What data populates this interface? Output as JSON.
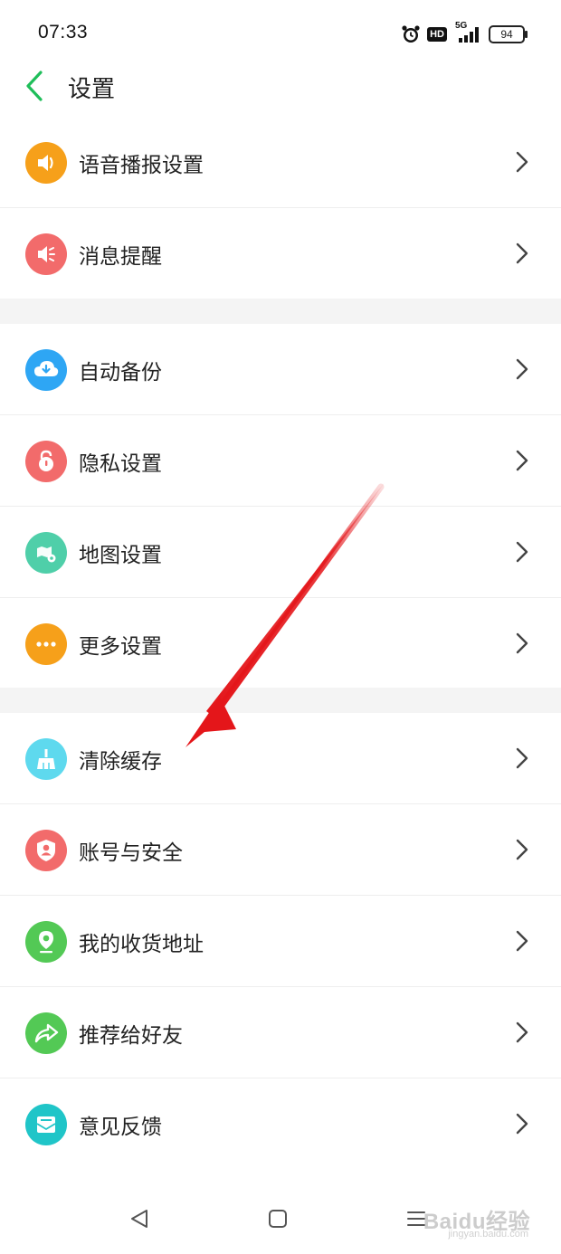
{
  "status_bar": {
    "time": "07:33",
    "network": "5G",
    "hd": "HD",
    "battery": "94"
  },
  "header": {
    "title": "设置",
    "accent_color": "#1fbe5a"
  },
  "groups": [
    {
      "items": [
        {
          "label": "语音播报设置",
          "icon": "speaker-icon",
          "color": "#f6a01a"
        },
        {
          "label": "消息提醒",
          "icon": "notification-icon",
          "color": "#f26b6b"
        }
      ]
    },
    {
      "items": [
        {
          "label": "自动备份",
          "icon": "cloud-download-icon",
          "color": "#2ea6f4"
        },
        {
          "label": "隐私设置",
          "icon": "lock-icon",
          "color": "#f26b6b"
        },
        {
          "label": "地图设置",
          "icon": "map-settings-icon",
          "color": "#4fcfa9"
        },
        {
          "label": "更多设置",
          "icon": "more-icon",
          "color": "#f6a01a"
        }
      ]
    },
    {
      "items": [
        {
          "label": "清除缓存",
          "icon": "broom-icon",
          "color": "#5ed9ee"
        },
        {
          "label": "账号与安全",
          "icon": "account-shield-icon",
          "color": "#f26b6b"
        },
        {
          "label": "我的收货地址",
          "icon": "location-pin-icon",
          "color": "#53c955"
        },
        {
          "label": "推荐给好友",
          "icon": "share-icon",
          "color": "#53c955"
        },
        {
          "label": "意见反馈",
          "icon": "feedback-mail-icon",
          "color": "#20c5c8"
        }
      ]
    }
  ],
  "annotation": {
    "arrow_color": "#e4161a"
  },
  "nav": {
    "back": "back-triangle-icon",
    "home": "home-square-icon",
    "menu": "menu-lines-icon"
  },
  "watermark": {
    "text": "Baidu经验",
    "sub": "jingyan.baidu.com"
  }
}
